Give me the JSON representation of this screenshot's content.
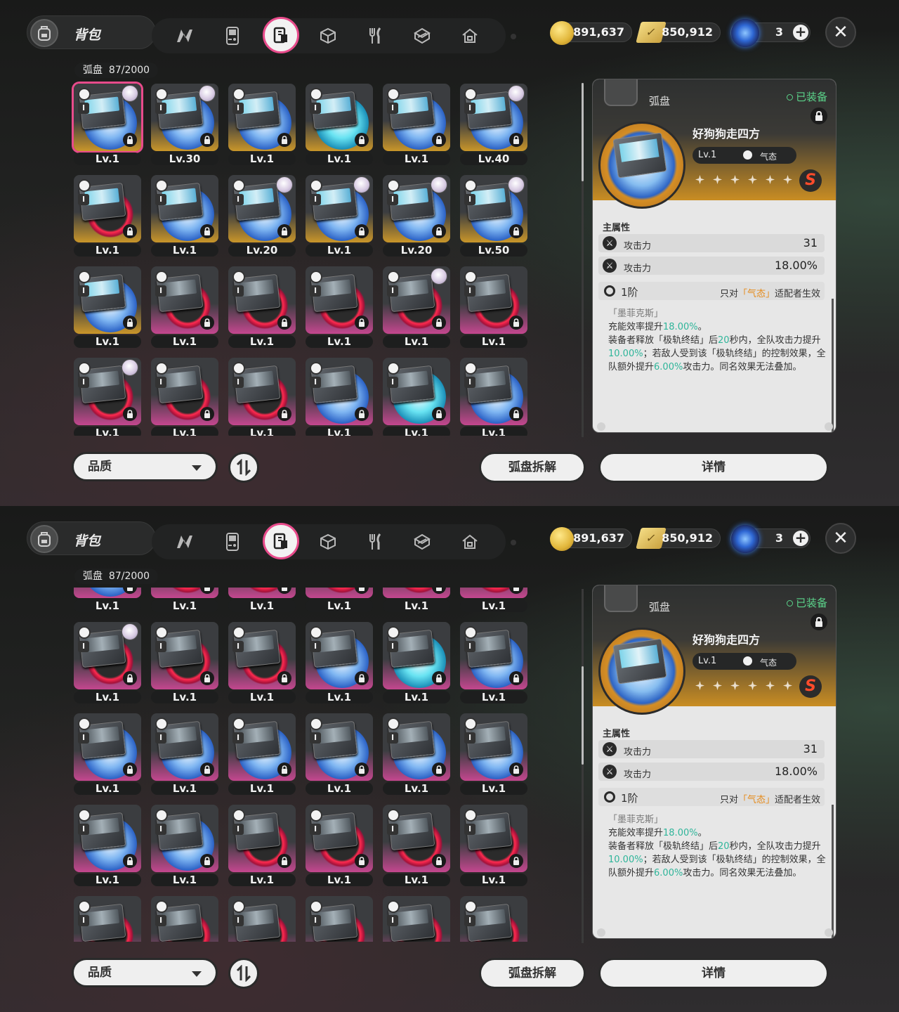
{
  "header": {
    "bag_title": "背包",
    "tabs": [
      {
        "icon": "n-logo-icon"
      },
      {
        "icon": "gameboy-icon"
      },
      {
        "icon": "disc-icon",
        "active": true
      },
      {
        "icon": "cube-icon"
      },
      {
        "icon": "fork-knife-icon"
      },
      {
        "icon": "cube-outline-icon"
      },
      {
        "icon": "house-icon"
      }
    ],
    "currencies": [
      {
        "icon": "coin-icon",
        "value": "891,637"
      },
      {
        "icon": "ticket-icon",
        "value": "850,912"
      },
      {
        "icon": "orb-icon",
        "value": "3"
      }
    ],
    "plus": "+",
    "close": "✕"
  },
  "inventory": {
    "label": "弧盘",
    "count": "87/2000"
  },
  "grid1": [
    {
      "lv": "Lv.1",
      "frame": "gold",
      "sel": true,
      "avatar": true
    },
    {
      "lv": "Lv.30",
      "frame": "gold",
      "avatar": true
    },
    {
      "lv": "Lv.1",
      "frame": "gold"
    },
    {
      "lv": "Lv.1",
      "frame": "gold",
      "cyan": true
    },
    {
      "lv": "Lv.1",
      "frame": "gold"
    },
    {
      "lv": "Lv.40",
      "frame": "gold",
      "avatar": true
    },
    {
      "lv": "Lv.1",
      "frame": "gold",
      "red": true
    },
    {
      "lv": "Lv.1",
      "frame": "gold"
    },
    {
      "lv": "Lv.20",
      "frame": "gold",
      "avatar": true
    },
    {
      "lv": "Lv.1",
      "frame": "gold",
      "avatar": true
    },
    {
      "lv": "Lv.20",
      "frame": "gold",
      "avatar": true
    },
    {
      "lv": "Lv.50",
      "frame": "gold",
      "avatar": true
    },
    {
      "lv": "Lv.1",
      "frame": "gold"
    },
    {
      "lv": "Lv.1",
      "frame": "pink",
      "red": true
    },
    {
      "lv": "Lv.1",
      "frame": "pink",
      "red": true
    },
    {
      "lv": "Lv.1",
      "frame": "pink",
      "red": true
    },
    {
      "lv": "Lv.1",
      "frame": "pink",
      "red": true,
      "avatar": true
    },
    {
      "lv": "Lv.1",
      "frame": "pink",
      "red": true
    },
    {
      "lv": "Lv.1",
      "frame": "pink",
      "red": true,
      "avatar": true
    },
    {
      "lv": "Lv.1",
      "frame": "pink",
      "red": true
    },
    {
      "lv": "Lv.1",
      "frame": "pink",
      "red": true
    },
    {
      "lv": "Lv.1",
      "frame": "pink"
    },
    {
      "lv": "Lv.1",
      "frame": "pink",
      "cyan": true
    },
    {
      "lv": "Lv.1",
      "frame": "pink"
    }
  ],
  "grid2": [
    {
      "lv": "Lv.1",
      "frame": "pink"
    },
    {
      "lv": "Lv.1",
      "frame": "pink",
      "red": true
    },
    {
      "lv": "Lv.1",
      "frame": "pink",
      "red": true
    },
    {
      "lv": "Lv.1",
      "frame": "pink",
      "red": true
    },
    {
      "lv": "Lv.1",
      "frame": "pink",
      "red": true
    },
    {
      "lv": "Lv.1",
      "frame": "pink",
      "red": true
    },
    {
      "lv": "Lv.1",
      "frame": "pink",
      "red": true,
      "avatar": true
    },
    {
      "lv": "Lv.1",
      "frame": "pink",
      "red": true
    },
    {
      "lv": "Lv.1",
      "frame": "pink",
      "red": true
    },
    {
      "lv": "Lv.1",
      "frame": "pink"
    },
    {
      "lv": "Lv.1",
      "frame": "pink",
      "cyan": true
    },
    {
      "lv": "Lv.1",
      "frame": "pink"
    },
    {
      "lv": "Lv.1",
      "frame": "pink"
    },
    {
      "lv": "Lv.1",
      "frame": "pink"
    },
    {
      "lv": "Lv.1",
      "frame": "pink"
    },
    {
      "lv": "Lv.1",
      "frame": "pink"
    },
    {
      "lv": "Lv.1",
      "frame": "pink"
    },
    {
      "lv": "Lv.1",
      "frame": "pink"
    },
    {
      "lv": "Lv.1",
      "frame": "pink"
    },
    {
      "lv": "Lv.1",
      "frame": "pink"
    },
    {
      "lv": "Lv.1",
      "frame": "pink",
      "red": true
    },
    {
      "lv": "Lv.1",
      "frame": "pink",
      "red": true
    },
    {
      "lv": "Lv.1",
      "frame": "pink",
      "red": true
    },
    {
      "lv": "Lv.1",
      "frame": "pink",
      "red": true
    },
    {
      "lv": "",
      "frame": "pink",
      "red": true
    },
    {
      "lv": "",
      "frame": "pink",
      "red": true
    },
    {
      "lv": "",
      "frame": "pink",
      "red": true
    },
    {
      "lv": "",
      "frame": "pink",
      "red": true
    },
    {
      "lv": "",
      "frame": "pink",
      "red": true
    },
    {
      "lv": "",
      "frame": "pink",
      "red": true
    }
  ],
  "card_rank": "I",
  "bottom": {
    "sort": "品质",
    "dismantle": "弧盘拆解",
    "details": "详情"
  },
  "detail": {
    "category": "弧盘",
    "equipped": "已装备",
    "name": "好狗狗走四方",
    "level": "Lv.1",
    "element": "气态",
    "rarity": "S",
    "main_stat_label": "主属性",
    "stats": [
      {
        "name": "攻击力",
        "value": "31"
      },
      {
        "name": "攻击力",
        "value": "18.00%"
      }
    ],
    "tier": "1阶",
    "cond_pre": "只对",
    "cond_elem": "「气态」",
    "cond_post": "适配者生效",
    "desc": {
      "source": "「墨菲克斯」",
      "p1": "充能效率提升",
      "v1": "18.00%",
      "p1b": "。",
      "p2": "装备者释放「极轨终结」后",
      "v2": "20",
      "p3": "秒内，全队攻击力提升",
      "v3": "10.00%",
      "p4": "；若敌人受到该「极轨终结」的控制效果，全队额外提升",
      "v4": "6.00%",
      "p5": "攻击力。同名效果无法叠加。"
    }
  }
}
